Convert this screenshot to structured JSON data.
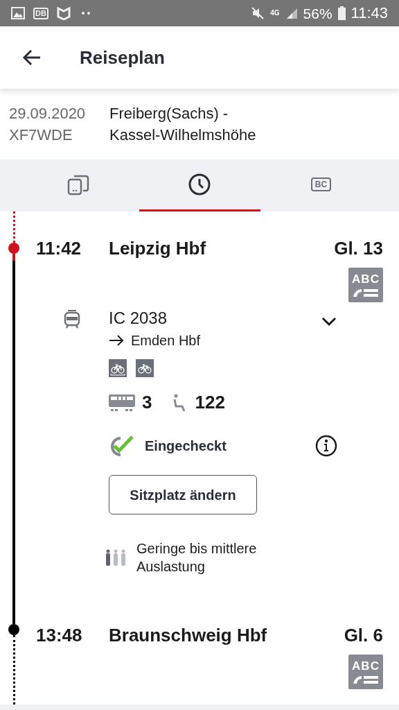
{
  "status_bar": {
    "db_label": "DB",
    "network": "4G",
    "battery": "56%",
    "time": "11:43"
  },
  "header": {
    "title": "Reiseplan"
  },
  "journey": {
    "date": "29.09.2020",
    "code": "XF7WDE",
    "route_lines": [
      "Freiberg(Sachs) -",
      "Kassel-Wilhelmshöhe"
    ]
  },
  "tabs": [
    {
      "kind": "ticket",
      "selected": false
    },
    {
      "kind": "schedule",
      "selected": true
    },
    {
      "kind": "bahncard",
      "label": "BC",
      "selected": false
    }
  ],
  "stops": [
    {
      "time": "11:42",
      "station": "Leipzig Hbf",
      "platform": "Gl. 13",
      "sector_sign": "ABC",
      "passed": true
    },
    {
      "time": "13:48",
      "station": "Braunschweig Hbf",
      "platform": "Gl. 6",
      "sector_sign": "ABC",
      "passed": false
    }
  ],
  "train": {
    "name": "IC 2038",
    "direction": "Emden Hbf",
    "expanded": false,
    "coach": "3",
    "seat": "122",
    "checkin": {
      "label": "Eingecheckt",
      "checked": true
    },
    "button": "Sitzplatz ändern",
    "occupancy": "Geringe bis mittlere Auslastung"
  }
}
